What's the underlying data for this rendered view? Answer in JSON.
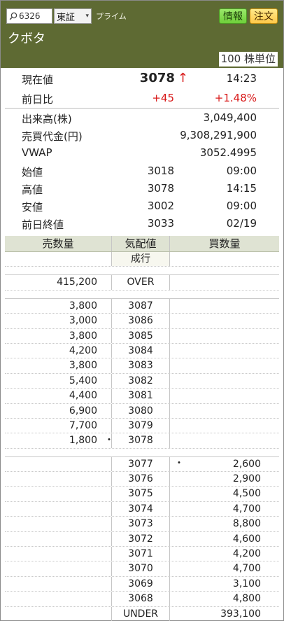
{
  "header": {
    "code_value": "6326",
    "market": "東証",
    "segment": "プライム",
    "info_button": "情報",
    "order_button": "注文",
    "stock_name": "クボタ",
    "unit": "100 株単位"
  },
  "quote": {
    "current_label": "現在値",
    "current_price": "3078",
    "current_arrow": "↑",
    "current_time": "14:23",
    "change_label": "前日比",
    "change_value": "+45",
    "change_percent": "+1.48%",
    "volume_label": "出来高(株)",
    "volume_value": "3,049,400",
    "turnover_label": "売買代金(円)",
    "turnover_value": "9,308,291,900",
    "vwap_label": "VWAP",
    "vwap_value": "3052.4995",
    "open_label": "始値",
    "open_value": "3018",
    "open_time": "09:00",
    "high_label": "高値",
    "high_value": "3078",
    "high_time": "14:15",
    "low_label": "安値",
    "low_value": "3002",
    "low_time": "09:00",
    "prev_close_label": "前日終値",
    "prev_close_value": "3033",
    "prev_close_date": "02/19"
  },
  "board": {
    "headers": {
      "sell": "売数量",
      "price": "気配値",
      "buy": "買数量"
    },
    "market_order": "成行",
    "over_qty": "415,200",
    "over_label": "OVER",
    "asks": [
      {
        "qty": "3,800",
        "price": "3087"
      },
      {
        "qty": "3,000",
        "price": "3086"
      },
      {
        "qty": "3,800",
        "price": "3085"
      },
      {
        "qty": "4,200",
        "price": "3084"
      },
      {
        "qty": "3,800",
        "price": "3083"
      },
      {
        "qty": "5,400",
        "price": "3082"
      },
      {
        "qty": "4,400",
        "price": "3081"
      },
      {
        "qty": "6,900",
        "price": "3080"
      },
      {
        "qty": "7,700",
        "price": "3079"
      },
      {
        "qty": "1,800",
        "price": "3078",
        "marker": "・"
      }
    ],
    "bids": [
      {
        "price": "3077",
        "qty": "2,600",
        "marker": "・"
      },
      {
        "price": "3076",
        "qty": "2,900"
      },
      {
        "price": "3075",
        "qty": "4,500"
      },
      {
        "price": "3074",
        "qty": "4,700"
      },
      {
        "price": "3073",
        "qty": "8,800"
      },
      {
        "price": "3072",
        "qty": "4,600"
      },
      {
        "price": "3071",
        "qty": "4,200"
      },
      {
        "price": "3070",
        "qty": "4,700"
      },
      {
        "price": "3069",
        "qty": "3,100"
      },
      {
        "price": "3068",
        "qty": "4,800"
      }
    ],
    "under_label": "UNDER",
    "under_qty": "393,100"
  },
  "colors": {
    "header_bg": "#5e6a33",
    "up_red": "#d81818",
    "board_header_bg": "#dfe3d3",
    "info_button": "#7ad84a",
    "order_button": "#ffd35a"
  }
}
